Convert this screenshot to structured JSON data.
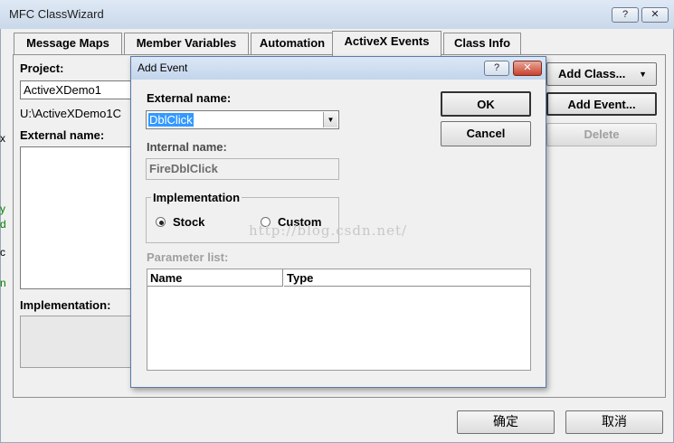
{
  "outer_window": {
    "title": "MFC ClassWizard",
    "help_button": "?",
    "close_button": "✕",
    "tabs": [
      "Message Maps",
      "Member Variables",
      "Automation",
      "ActiveX Events",
      "Class Info"
    ],
    "active_tab": "ActiveX Events",
    "project_label": "Project:",
    "project_value": "ActiveXDemo1",
    "path_value": "U:\\ActiveXDemo1C",
    "external_name_label": "External name:",
    "implementation_label": "Implementation:",
    "add_class_button": "Add Class...",
    "add_event_button": "Add Event...",
    "delete_button": "Delete",
    "ok_button": "确定",
    "cancel_button": "取消",
    "margin_chars": [
      "y",
      "d",
      "c",
      "n"
    ]
  },
  "dialog": {
    "title": "Add Event",
    "help_button": "?",
    "close_button": "✕",
    "external_name_label": "External name:",
    "external_name_value": "DblClick",
    "internal_name_label": "Internal name:",
    "internal_name_value": "FireDblClick",
    "implementation_group": "Implementation",
    "radio_stock": "Stock",
    "radio_custom": "Custom",
    "selected_radio": "Stock",
    "parameter_list_label": "Parameter list:",
    "columns": [
      "Name",
      "Type"
    ],
    "ok_button": "OK",
    "cancel_button": "Cancel"
  },
  "watermark": "http://blog.csdn.net/",
  "colors": {
    "selection": "#3399ff",
    "green_text": "#008000",
    "title_gradient_top": "#dbe7f5"
  }
}
